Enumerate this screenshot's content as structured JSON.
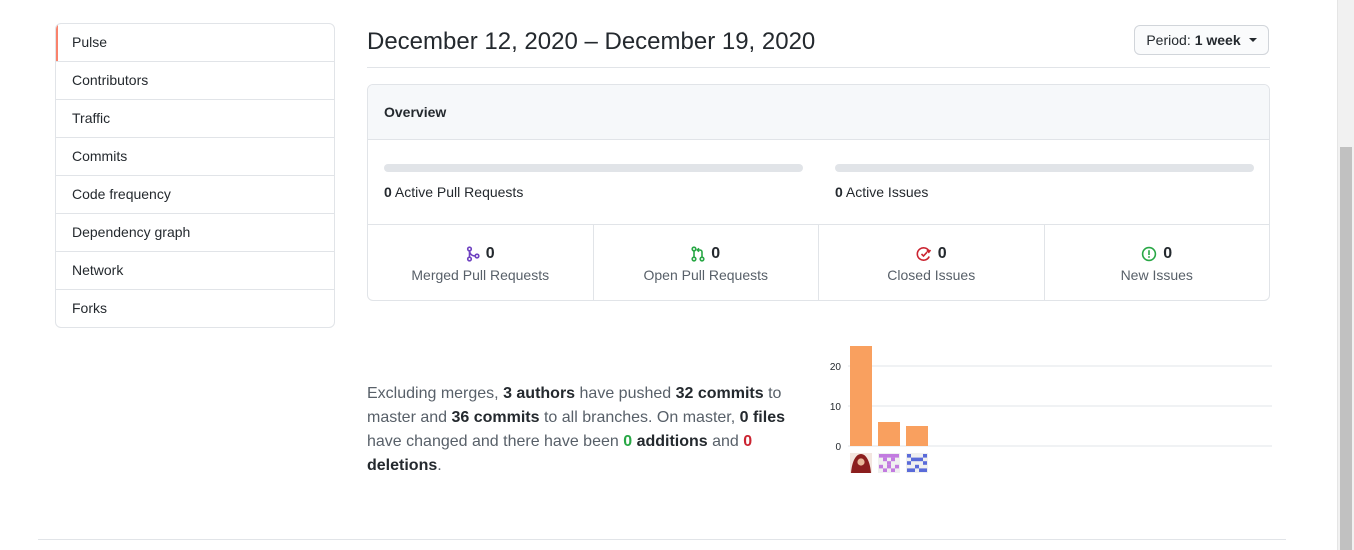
{
  "sidebar": {
    "items": [
      {
        "label": "Pulse",
        "selected": true
      },
      {
        "label": "Contributors"
      },
      {
        "label": "Traffic"
      },
      {
        "label": "Commits"
      },
      {
        "label": "Code frequency"
      },
      {
        "label": "Dependency graph"
      },
      {
        "label": "Network"
      },
      {
        "label": "Forks"
      }
    ]
  },
  "header": {
    "date_range": "December 12, 2020 – December 19, 2020",
    "period_prefix": "Period:",
    "period_value": "1 week"
  },
  "overview": {
    "title": "Overview",
    "pull_requests": {
      "count": "0",
      "label": "Active Pull Requests",
      "progress": 0
    },
    "issues": {
      "count": "0",
      "label": "Active Issues",
      "progress": 0
    },
    "stats": [
      {
        "icon": "git-merge-icon",
        "count": "0",
        "label": "Merged Pull Requests",
        "color": "#6f42c1"
      },
      {
        "icon": "git-pull-request-icon",
        "count": "0",
        "label": "Open Pull Requests",
        "color": "#28a745"
      },
      {
        "icon": "issue-closed-icon",
        "count": "0",
        "label": "Closed Issues",
        "color": "#cb2431"
      },
      {
        "icon": "issue-opened-icon",
        "count": "0",
        "label": "New Issues",
        "color": "#28a745"
      }
    ]
  },
  "summary": {
    "t1": "Excluding merges, ",
    "authors": "3 authors",
    "t2": " have pushed ",
    "commits_master": "32 commits",
    "t3": " to master and ",
    "commits_all": "36 commits",
    "t4": " to all branches. On master, ",
    "files": "0 files",
    "t5": " have changed and there have been ",
    "additions_count": "0",
    "additions_word": " additions",
    "t6": " and ",
    "deletions_count": "0",
    "deletions_word": " deletions",
    "t7": "."
  },
  "chart_data": {
    "type": "bar",
    "categories": [
      "author-1",
      "author-2",
      "author-3"
    ],
    "values": [
      25,
      6,
      5
    ],
    "ylim": [
      0,
      25
    ],
    "yticks": [
      "0",
      "10",
      "20"
    ],
    "grid": true,
    "bar_color": "#f9a05f"
  },
  "colors": {
    "accent": "#f9826c",
    "border": "#e1e4e8",
    "purple": "#6f42c1",
    "green": "#28a745",
    "red": "#cb2431"
  }
}
